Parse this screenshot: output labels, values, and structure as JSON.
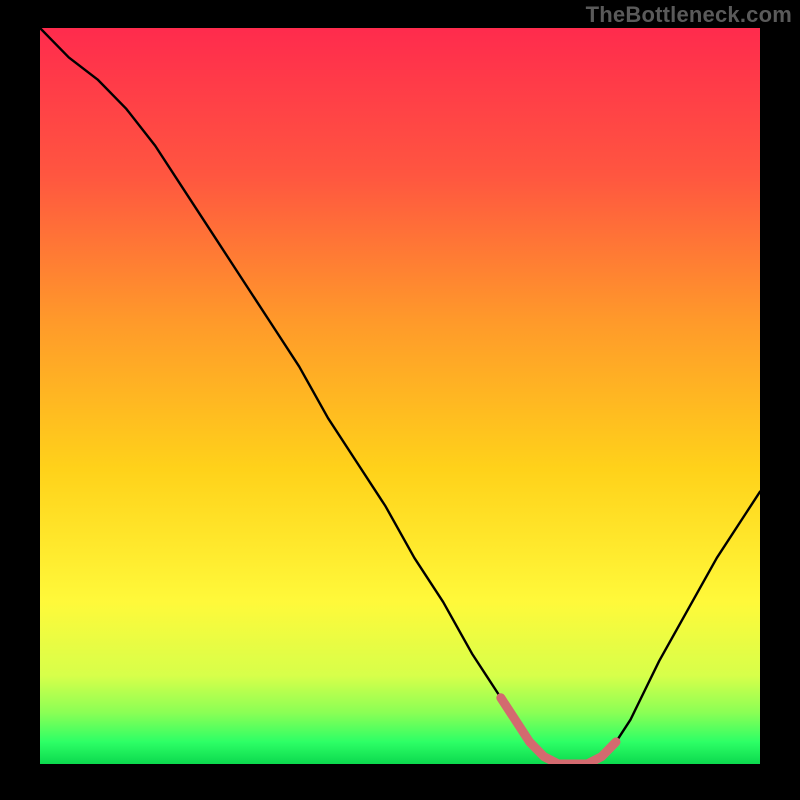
{
  "watermark": "TheBottleneck.com",
  "chart_data": {
    "type": "line",
    "title": "",
    "xlabel": "",
    "ylabel": "",
    "xlim": [
      0,
      100
    ],
    "ylim": [
      0,
      100
    ],
    "grid": false,
    "legend": false,
    "series": [
      {
        "name": "bottleneck-curve",
        "x": [
          0,
          4,
          8,
          12,
          16,
          20,
          24,
          28,
          32,
          36,
          40,
          44,
          48,
          52,
          56,
          60,
          62,
          64,
          66,
          68,
          70,
          72,
          74,
          76,
          78,
          80,
          82,
          84,
          86,
          90,
          94,
          98,
          100
        ],
        "y": [
          100,
          96,
          93,
          89,
          84,
          78,
          72,
          66,
          60,
          54,
          47,
          41,
          35,
          28,
          22,
          15,
          12,
          9,
          6,
          3,
          1,
          0,
          0,
          0,
          1,
          3,
          6,
          10,
          14,
          21,
          28,
          34,
          37
        ]
      }
    ],
    "gradient_stops": [
      {
        "offset": 0.0,
        "color": "#ff2b4d"
      },
      {
        "offset": 0.2,
        "color": "#ff5640"
      },
      {
        "offset": 0.4,
        "color": "#ff9a2a"
      },
      {
        "offset": 0.6,
        "color": "#ffd21a"
      },
      {
        "offset": 0.78,
        "color": "#fff93a"
      },
      {
        "offset": 0.88,
        "color": "#d7ff4a"
      },
      {
        "offset": 0.93,
        "color": "#8bff55"
      },
      {
        "offset": 0.97,
        "color": "#2dff66"
      },
      {
        "offset": 1.0,
        "color": "#0cd94e"
      }
    ],
    "highlight_segment": {
      "name": "optimal-range",
      "x_start": 64,
      "x_end": 80,
      "color": "#d36a6f"
    }
  }
}
